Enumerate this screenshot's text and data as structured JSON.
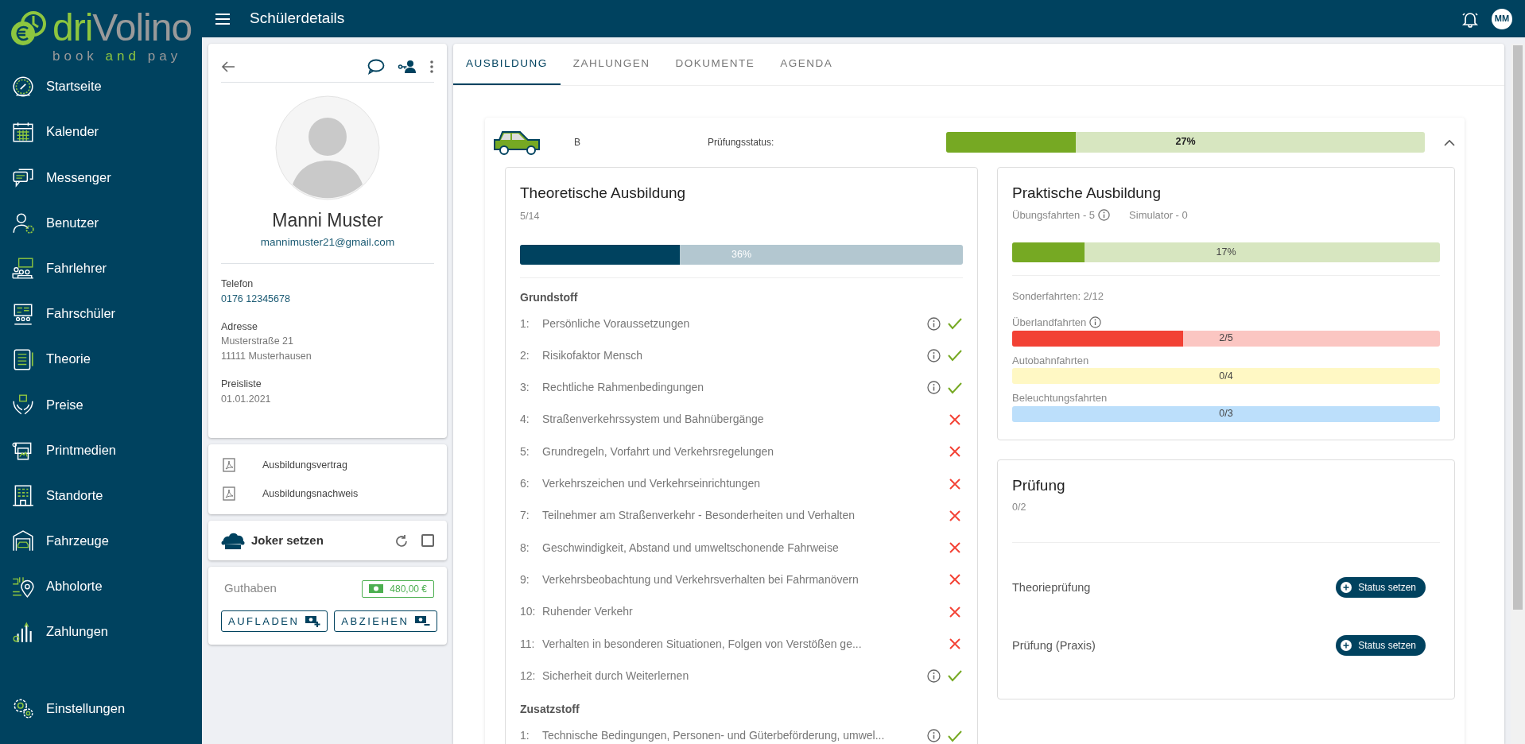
{
  "logo": {
    "brand": [
      "dri",
      "Volino"
    ],
    "tagline": [
      "book",
      "and",
      "pay"
    ]
  },
  "sidebar": {
    "items": [
      {
        "label": "Startseite"
      },
      {
        "label": "Kalender"
      },
      {
        "label": "Messenger"
      },
      {
        "label": "Benutzer"
      },
      {
        "label": "Fahrlehrer"
      },
      {
        "label": "Fahrschüler"
      },
      {
        "label": "Theorie"
      },
      {
        "label": "Preise"
      },
      {
        "label": "Printmedien"
      },
      {
        "label": "Standorte"
      },
      {
        "label": "Fahrzeuge"
      },
      {
        "label": "Abholorte"
      },
      {
        "label": "Zahlungen"
      }
    ],
    "footer_item": {
      "label": "Einstellungen"
    }
  },
  "header": {
    "title": "Schülerdetails",
    "avatar_initials": "MM"
  },
  "student": {
    "name": "Manni Muster",
    "email": "mannimuster21@gmail.com",
    "fields": [
      {
        "label": "Telefon",
        "kind": "link",
        "lines": [
          "0176 12345678"
        ]
      },
      {
        "label": "Adresse",
        "kind": "text",
        "lines": [
          "Musterstraße 21",
          "11111 Musterhausen"
        ]
      },
      {
        "label": "Preisliste",
        "kind": "text",
        "lines": [
          "01.01.2021"
        ]
      }
    ]
  },
  "documents": [
    {
      "label": "Ausbildungsvertrag"
    },
    {
      "label": "Ausbildungsnachweis"
    }
  ],
  "joker": {
    "label": "Joker setzen",
    "checked": false
  },
  "balance": {
    "label": "Guthaben",
    "amount": "480,00 €",
    "buttons": [
      {
        "label": "AUFLADEN",
        "kind": "add"
      },
      {
        "label": "ABZIEHEN",
        "kind": "remove"
      }
    ]
  },
  "tabs": [
    {
      "label": "AUSBILDUNG",
      "selected": true
    },
    {
      "label": "ZAHLUNGEN",
      "selected": false
    },
    {
      "label": "DOKUMENTE",
      "selected": false
    },
    {
      "label": "AGENDA",
      "selected": false
    }
  ],
  "license": {
    "class": "B",
    "status_label": "Prüfungsstatus:",
    "level": 0.27,
    "reading": "27%",
    "expanded": true
  },
  "theory": {
    "title": "Theoretische Ausbildung",
    "count": "5/14",
    "level": 0.36,
    "reading": "36%",
    "sections": [
      {
        "title": "Grundstoff",
        "items": [
          {
            "number": "1:",
            "text": "Persönliche Voraussetzungen",
            "done": true
          },
          {
            "number": "2:",
            "text": "Risikofaktor Mensch",
            "done": true
          },
          {
            "number": "3:",
            "text": "Rechtliche Rahmenbedingungen",
            "done": true
          },
          {
            "number": "4:",
            "text": "Straßenverkehrssystem und Bahnübergänge",
            "done": false
          },
          {
            "number": "5:",
            "text": "Grundregeln, Vorfahrt und Verkehrsregelungen",
            "done": false
          },
          {
            "number": "6:",
            "text": "Verkehrszeichen und Verkehrseinrichtungen",
            "done": false
          },
          {
            "number": "7:",
            "text": "Teilnehmer am Straßenverkehr - Besonderheiten und Verhalten",
            "done": false
          },
          {
            "number": "8:",
            "text": "Geschwindigkeit, Abstand und umweltschonende Fahrweise",
            "done": false
          },
          {
            "number": "9:",
            "text": "Verkehrsbeobachtung und Verkehrsverhalten bei Fahrmanövern",
            "done": false
          },
          {
            "number": "10:",
            "text": "Ruhender Verkehr",
            "done": false
          },
          {
            "number": "11:",
            "text": "Verhalten in besonderen Situationen, Folgen von Verstößen ge...",
            "done": false
          },
          {
            "number": "12:",
            "text": "Sicherheit durch Weiterlernen",
            "done": true
          }
        ]
      },
      {
        "title": "Zusatzstoff",
        "items": [
          {
            "number": "1:",
            "text": "Technische Bedingungen, Personen- und Güterbeförderung, umwel...",
            "done": true
          }
        ]
      }
    ]
  },
  "practice": {
    "title": "Praktische Ausbildung",
    "counters": [
      {
        "text": "Übungsfahrten - 5",
        "info": true
      },
      {
        "text": "Simulator - 0",
        "info": false
      }
    ],
    "level": 0.17,
    "reading": "17%",
    "special_summary": "Sonderfahrten: 2/12",
    "special": [
      {
        "label": "Überlandfahrten",
        "info": true,
        "level": 0.4,
        "reading": "2/5",
        "color": "#fbc6c2"
      },
      {
        "label": "Autobahnfahrten",
        "info": false,
        "level": 0,
        "reading": "0/4",
        "color": "#fff8c4"
      },
      {
        "label": "Beleuchtungsfahrten",
        "info": false,
        "level": 0,
        "reading": "0/3",
        "color": "#bcdffb"
      }
    ]
  },
  "exam": {
    "title": "Prüfung",
    "count": "0/2",
    "items": [
      {
        "label": "Theorieprüfung",
        "button": "Status setzen"
      },
      {
        "label": "Prüfung (Praxis)",
        "button": "Status setzen"
      }
    ]
  }
}
